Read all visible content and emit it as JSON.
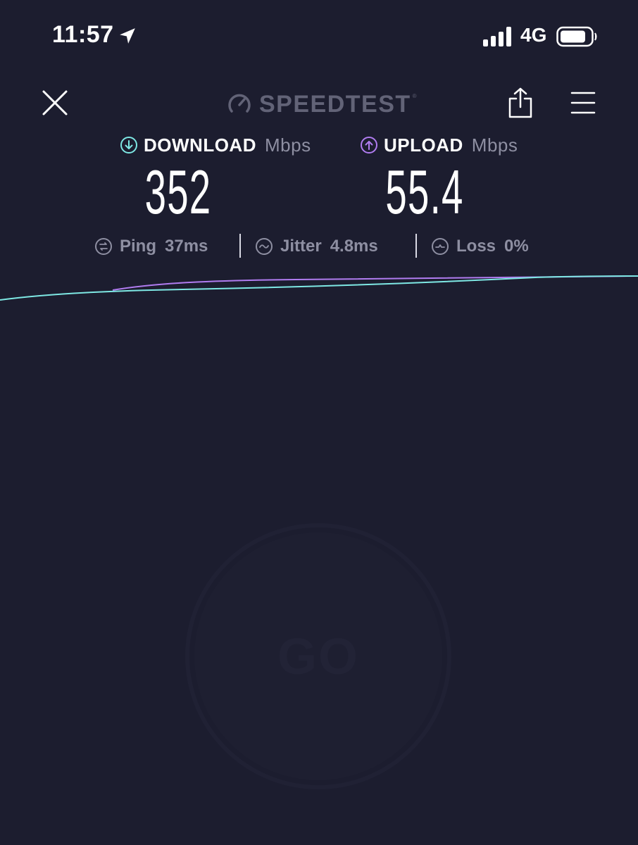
{
  "status_bar": {
    "time": "11:57",
    "network": "4G",
    "icons": [
      "location-arrow-icon",
      "cellular-signal-icon",
      "battery-icon"
    ]
  },
  "header": {
    "brand": "SPEEDTEST",
    "brand_mark": "®",
    "icons": [
      "close-icon",
      "speedometer-icon",
      "share-icon",
      "hamburger-menu-icon"
    ]
  },
  "results": {
    "download": {
      "label": "DOWNLOAD",
      "unit": "Mbps",
      "value": "352",
      "icon": "arrow-down-circle-icon",
      "color": "#7ee8e4"
    },
    "upload": {
      "label": "UPLOAD",
      "unit": "Mbps",
      "value": "55.4",
      "icon": "arrow-up-circle-icon",
      "color": "#b07cf0"
    },
    "ping": {
      "label": "Ping",
      "value": "37ms",
      "icon": "ping-icon"
    },
    "jitter": {
      "label": "Jitter",
      "value": "4.8ms",
      "icon": "jitter-icon"
    },
    "loss": {
      "label": "Loss",
      "value": "0%",
      "icon": "loss-icon"
    }
  },
  "go_button": {
    "label": "GO"
  },
  "colors": {
    "background": "#1c1d2f",
    "download_line": "#7ee8e4",
    "upload_line": "#b07cf0",
    "muted_text": "#8e8fa2"
  }
}
